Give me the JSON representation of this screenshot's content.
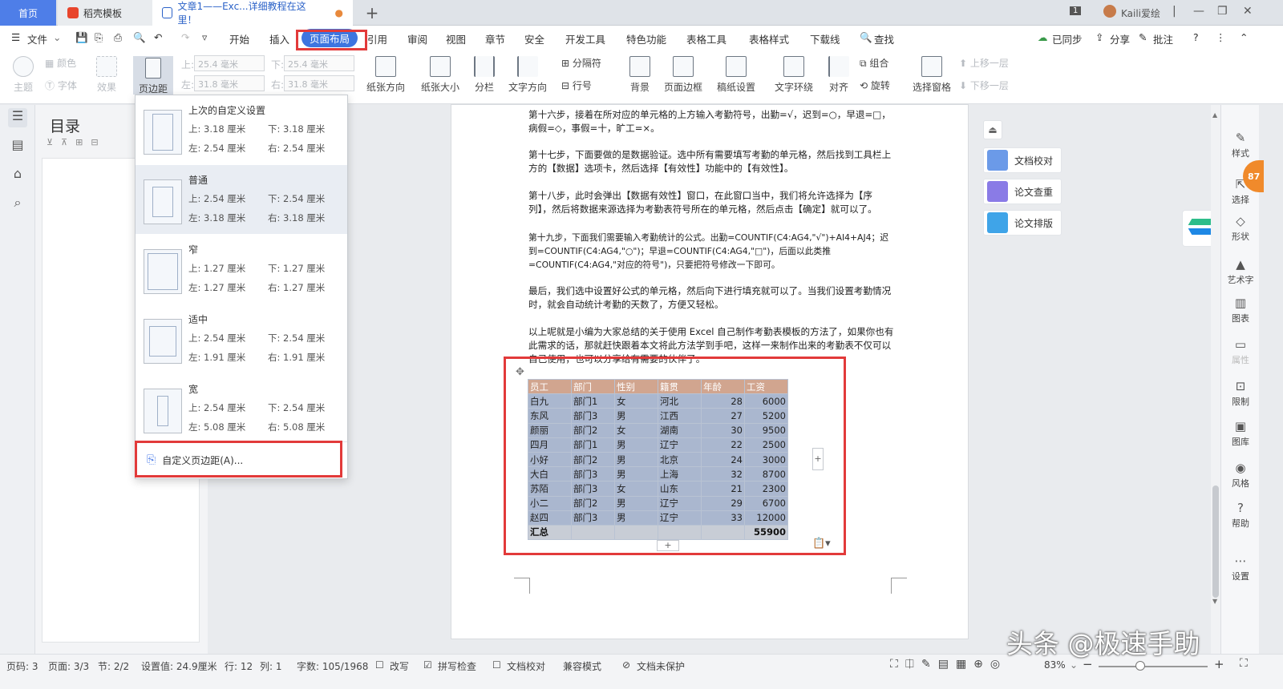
{
  "tabs": {
    "home": "首页",
    "template": "稻壳模板",
    "doc": "文章1——Exc...详细教程在这里！",
    "add": "+"
  },
  "titlebar": {
    "badge": "1",
    "user": "Kaili爱绘"
  },
  "menu": {
    "file": "文件",
    "start": "开始",
    "insert": "插入",
    "layout": "页面布局",
    "ref": "引用",
    "review": "审阅",
    "view": "视图",
    "chapter": "章节",
    "security": "安全",
    "devtools": "开发工具",
    "special": "特色功能",
    "tabletools": "表格工具",
    "tablestyle": "表格样式",
    "download": "下载线",
    "search": "查找",
    "sync": "已同步",
    "share": "分享",
    "annotate": "批注"
  },
  "ribbon": {
    "theme": "主题",
    "color": "颜色",
    "font": "字体",
    "effect": "效果",
    "margin": "页边距",
    "top_lbl": "上:",
    "top_val": "25.4 毫米",
    "bottom_lbl": "下:",
    "bottom_val": "25.4 毫米",
    "left_lbl": "左:",
    "left_val": "31.8 毫米",
    "right_lbl": "右:",
    "right_val": "31.8 毫米",
    "orient": "纸张方向",
    "size": "纸张大小",
    "columns": "分栏",
    "textdir": "文字方向",
    "linenum": "行号",
    "sep": "分隔符",
    "bg": "背景",
    "border": "页面边框",
    "paper": "稿纸设置",
    "wrap": "文字环绕",
    "align": "对齐",
    "group": "组合",
    "rotate": "旋转",
    "pane": "选择窗格",
    "up": "上移一层",
    "down": "下移一层"
  },
  "nav": {
    "title": "目录"
  },
  "margin_menu": {
    "options": [
      {
        "name": "上次的自定义设置",
        "top": "上: 3.18 厘米",
        "bottom": "下: 3.18 厘米",
        "left": "左: 2.54 厘米",
        "right": "右: 2.54 厘米"
      },
      {
        "name": "普通",
        "top": "上: 2.54 厘米",
        "bottom": "下: 2.54 厘米",
        "left": "左: 3.18 厘米",
        "right": "右: 3.18 厘米"
      },
      {
        "name": "窄",
        "top": "上: 1.27 厘米",
        "bottom": "下: 1.27 厘米",
        "left": "左: 1.27 厘米",
        "right": "右: 1.27 厘米"
      },
      {
        "name": "适中",
        "top": "上: 2.54 厘米",
        "bottom": "下: 2.54 厘米",
        "left": "左: 1.91 厘米",
        "right": "右: 1.91 厘米"
      },
      {
        "name": "宽",
        "top": "上: 2.54 厘米",
        "bottom": "下: 2.54 厘米",
        "left": "左: 5.08 厘米",
        "right": "右: 5.08 厘米"
      }
    ],
    "custom": "自定义页边距(A)..."
  },
  "doc": {
    "p1": "第十六步，接着在所对应的单元格的上方输入考勤符号，出勤=√，迟到=○，早退=□，病假=◇，事假=十，旷工=×。",
    "p2": "第十七步，下面要做的是数据验证。选中所有需要填写考勤的单元格，然后找到工具栏上方的【数据】选项卡，然后选择【有效性】功能中的【有效性】。",
    "p3": "第十八步，此时会弹出【数据有效性】窗口，在此窗口当中，我们将允许选择为【序列】，然后将数据来源选择为考勤表符号所在的单元格，然后点击【确定】就可以了。",
    "p4": "第十九步，下面我们需要输入考勤统计的公式。出勤=COUNTIF(C4:AG4,\"√\")+AI4+AJ4；迟到=COUNTIF(C4:AG4,\"○\")；早退=COUNTIF(C4:AG4,\"□\")，后面以此类推=COUNTIF(C4:AG4,\"对应的符号\")，只要把符号修改一下即可。",
    "p5": "最后，我们选中设置好公式的单元格，然后向下进行填充就可以了。当我们设置考勤情况时，就会自动统计考勤的天数了，方便又轻松。",
    "p6": "以上呢就是小编为大家总结的关于使用 Excel 自己制作考勤表模板的方法了，如果你也有此需求的话，那就赶快跟着本文将此方法学到手吧，这样一来制作出来的考勤表不仅可以自己使用，也可以分享给有需要的伙伴了。"
  },
  "table": {
    "headers": [
      "员工",
      "部门",
      "性别",
      "籍贯",
      "年龄",
      "工资"
    ],
    "rows": [
      [
        "白九",
        "部门1",
        "女",
        "河北",
        "28",
        "6000"
      ],
      [
        "东风",
        "部门3",
        "男",
        "江西",
        "27",
        "5200"
      ],
      [
        "颜丽",
        "部门2",
        "女",
        "湖南",
        "30",
        "9500"
      ],
      [
        "四月",
        "部门1",
        "男",
        "辽宁",
        "22",
        "2500"
      ],
      [
        "小好",
        "部门2",
        "男",
        "北京",
        "24",
        "3000"
      ],
      [
        "大白",
        "部门3",
        "男",
        "上海",
        "32",
        "8700"
      ],
      [
        "苏陌",
        "部门3",
        "女",
        "山东",
        "21",
        "2300"
      ],
      [
        "小二",
        "部门2",
        "男",
        "辽宁",
        "29",
        "6700"
      ],
      [
        "赵四",
        "部门3",
        "男",
        "辽宁",
        "33",
        "12000"
      ]
    ],
    "summary": [
      "汇总",
      "",
      "",
      "",
      "",
      "55900"
    ]
  },
  "float_panel": {
    "check": "文档校对",
    "plag": "论文查重",
    "format": "论文排版"
  },
  "right_sidebar": [
    "样式",
    "选择",
    "形状",
    "艺术字",
    "图表",
    "属性",
    "限制",
    "图库",
    "风格",
    "帮助",
    "设置"
  ],
  "badge_num": "87",
  "status": {
    "page": "页码: 3",
    "pages": "页面: 3/3",
    "section": "节: 2/2",
    "setting": "设置值: 24.9厘米",
    "row": "行: 12",
    "col": "列: 1",
    "words": "字数: 105/1968",
    "revise": "改写",
    "spell": "拼写检查",
    "proof": "文档校对",
    "compat": "兼容模式",
    "protect": "文档未保护",
    "zoom": "83%"
  },
  "watermark": "头条 @极速手助",
  "colors": {
    "accent": "#3d75e0",
    "highlight": "#e23a3a",
    "table_header": "#d1a58f",
    "table_row": "#aab7cf"
  }
}
